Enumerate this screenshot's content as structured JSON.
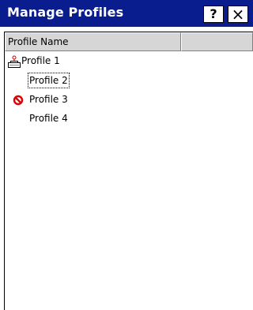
{
  "window": {
    "title": "Manage Profiles",
    "help_label": "?",
    "close_label": "×"
  },
  "list": {
    "columns": [
      "Profile Name",
      ""
    ],
    "rows": [
      {
        "label": "Profile 1",
        "icon": "printer-icon",
        "focused": false
      },
      {
        "label": "Profile 2",
        "icon": null,
        "focused": true
      },
      {
        "label": "Profile 3",
        "icon": "prohibited-icon",
        "focused": false
      },
      {
        "label": "Profile 4",
        "icon": null,
        "focused": false
      }
    ]
  },
  "colors": {
    "titlebar": "#0a1d8e",
    "header_bg": "#d6d6d6",
    "prohibited_icon": "#e00000"
  }
}
